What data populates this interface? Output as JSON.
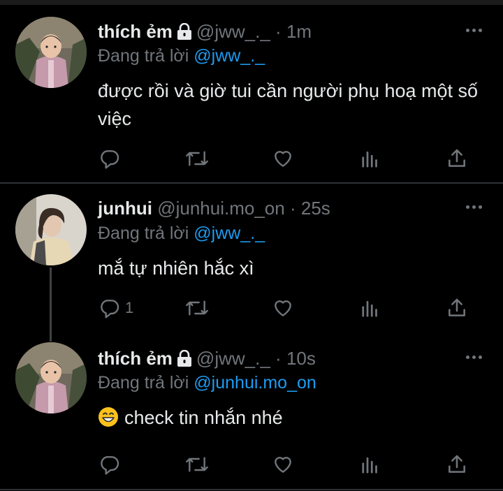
{
  "tweets": [
    {
      "display_name": "thích ẻm",
      "protected": true,
      "handle": "@jww_._",
      "separator": "·",
      "time": "1m",
      "reply_prefix": "Đang trả lời",
      "reply_mention": "@jww_._",
      "text": "được rồi và giờ tui cần người phụ hoạ một số việc",
      "reply_count": ""
    },
    {
      "display_name": "junhui",
      "protected": false,
      "handle": "@junhui.mo_on",
      "separator": "·",
      "time": "25s",
      "reply_prefix": "Đang trả lời",
      "reply_mention": "@jww_._",
      "text": "mắ tự nhiên hắc xì",
      "reply_count": "1"
    },
    {
      "display_name": "thích ẻm",
      "protected": true,
      "handle": "@jww_._",
      "separator": "·",
      "time": "10s",
      "reply_prefix": "Đang trả lời",
      "reply_mention": "@junhui.mo_on",
      "text": "check tin nhắn nhé",
      "text_emoji": "grinning-face-emoji",
      "reply_count": ""
    }
  ],
  "colors": {
    "background": "#000000",
    "text": "#e7e9ea",
    "muted": "#71767b",
    "accent": "#1d9bf0",
    "divider": "#2f3336"
  },
  "icons": [
    "lock-icon",
    "more-icon",
    "reply-icon",
    "retweet-icon",
    "like-icon",
    "views-icon",
    "share-icon"
  ]
}
